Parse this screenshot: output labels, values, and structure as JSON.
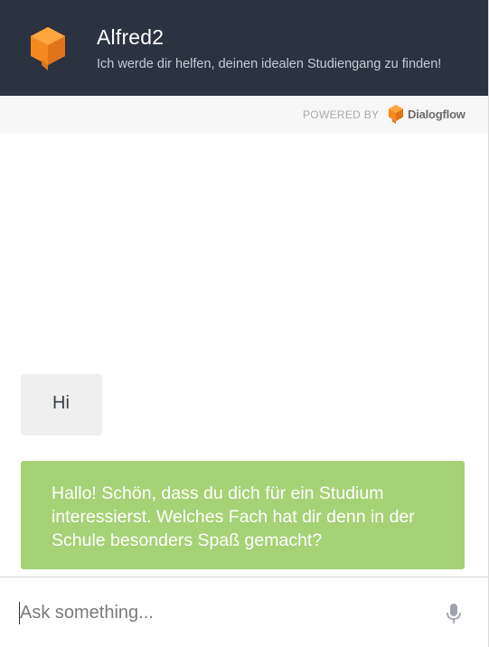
{
  "header": {
    "agent_name": "Alfred2",
    "agent_description": "Ich werde dir helfen, deinen idealen Studiengang zu finden!",
    "logo_icon": "orange-cube-icon"
  },
  "powered_by": {
    "label": "POWERED BY",
    "brand": "Dialogflow",
    "brand_icon": "dialogflow-icon"
  },
  "messages": [
    {
      "from": "user",
      "text": "Hi"
    },
    {
      "from": "bot",
      "text": "Hallo! Schön, dass du dich für ein Studium interessierst. Welches Fach hat dir denn in der Schule besonders Spaß gemacht?"
    }
  ],
  "input": {
    "placeholder": "Ask something...",
    "value": "",
    "mic_icon": "microphone-icon"
  },
  "colors": {
    "header_bg": "#2b3240",
    "accent_orange": "#f5891f",
    "bot_bubble": "#a5d275",
    "user_bubble": "#efefef"
  }
}
